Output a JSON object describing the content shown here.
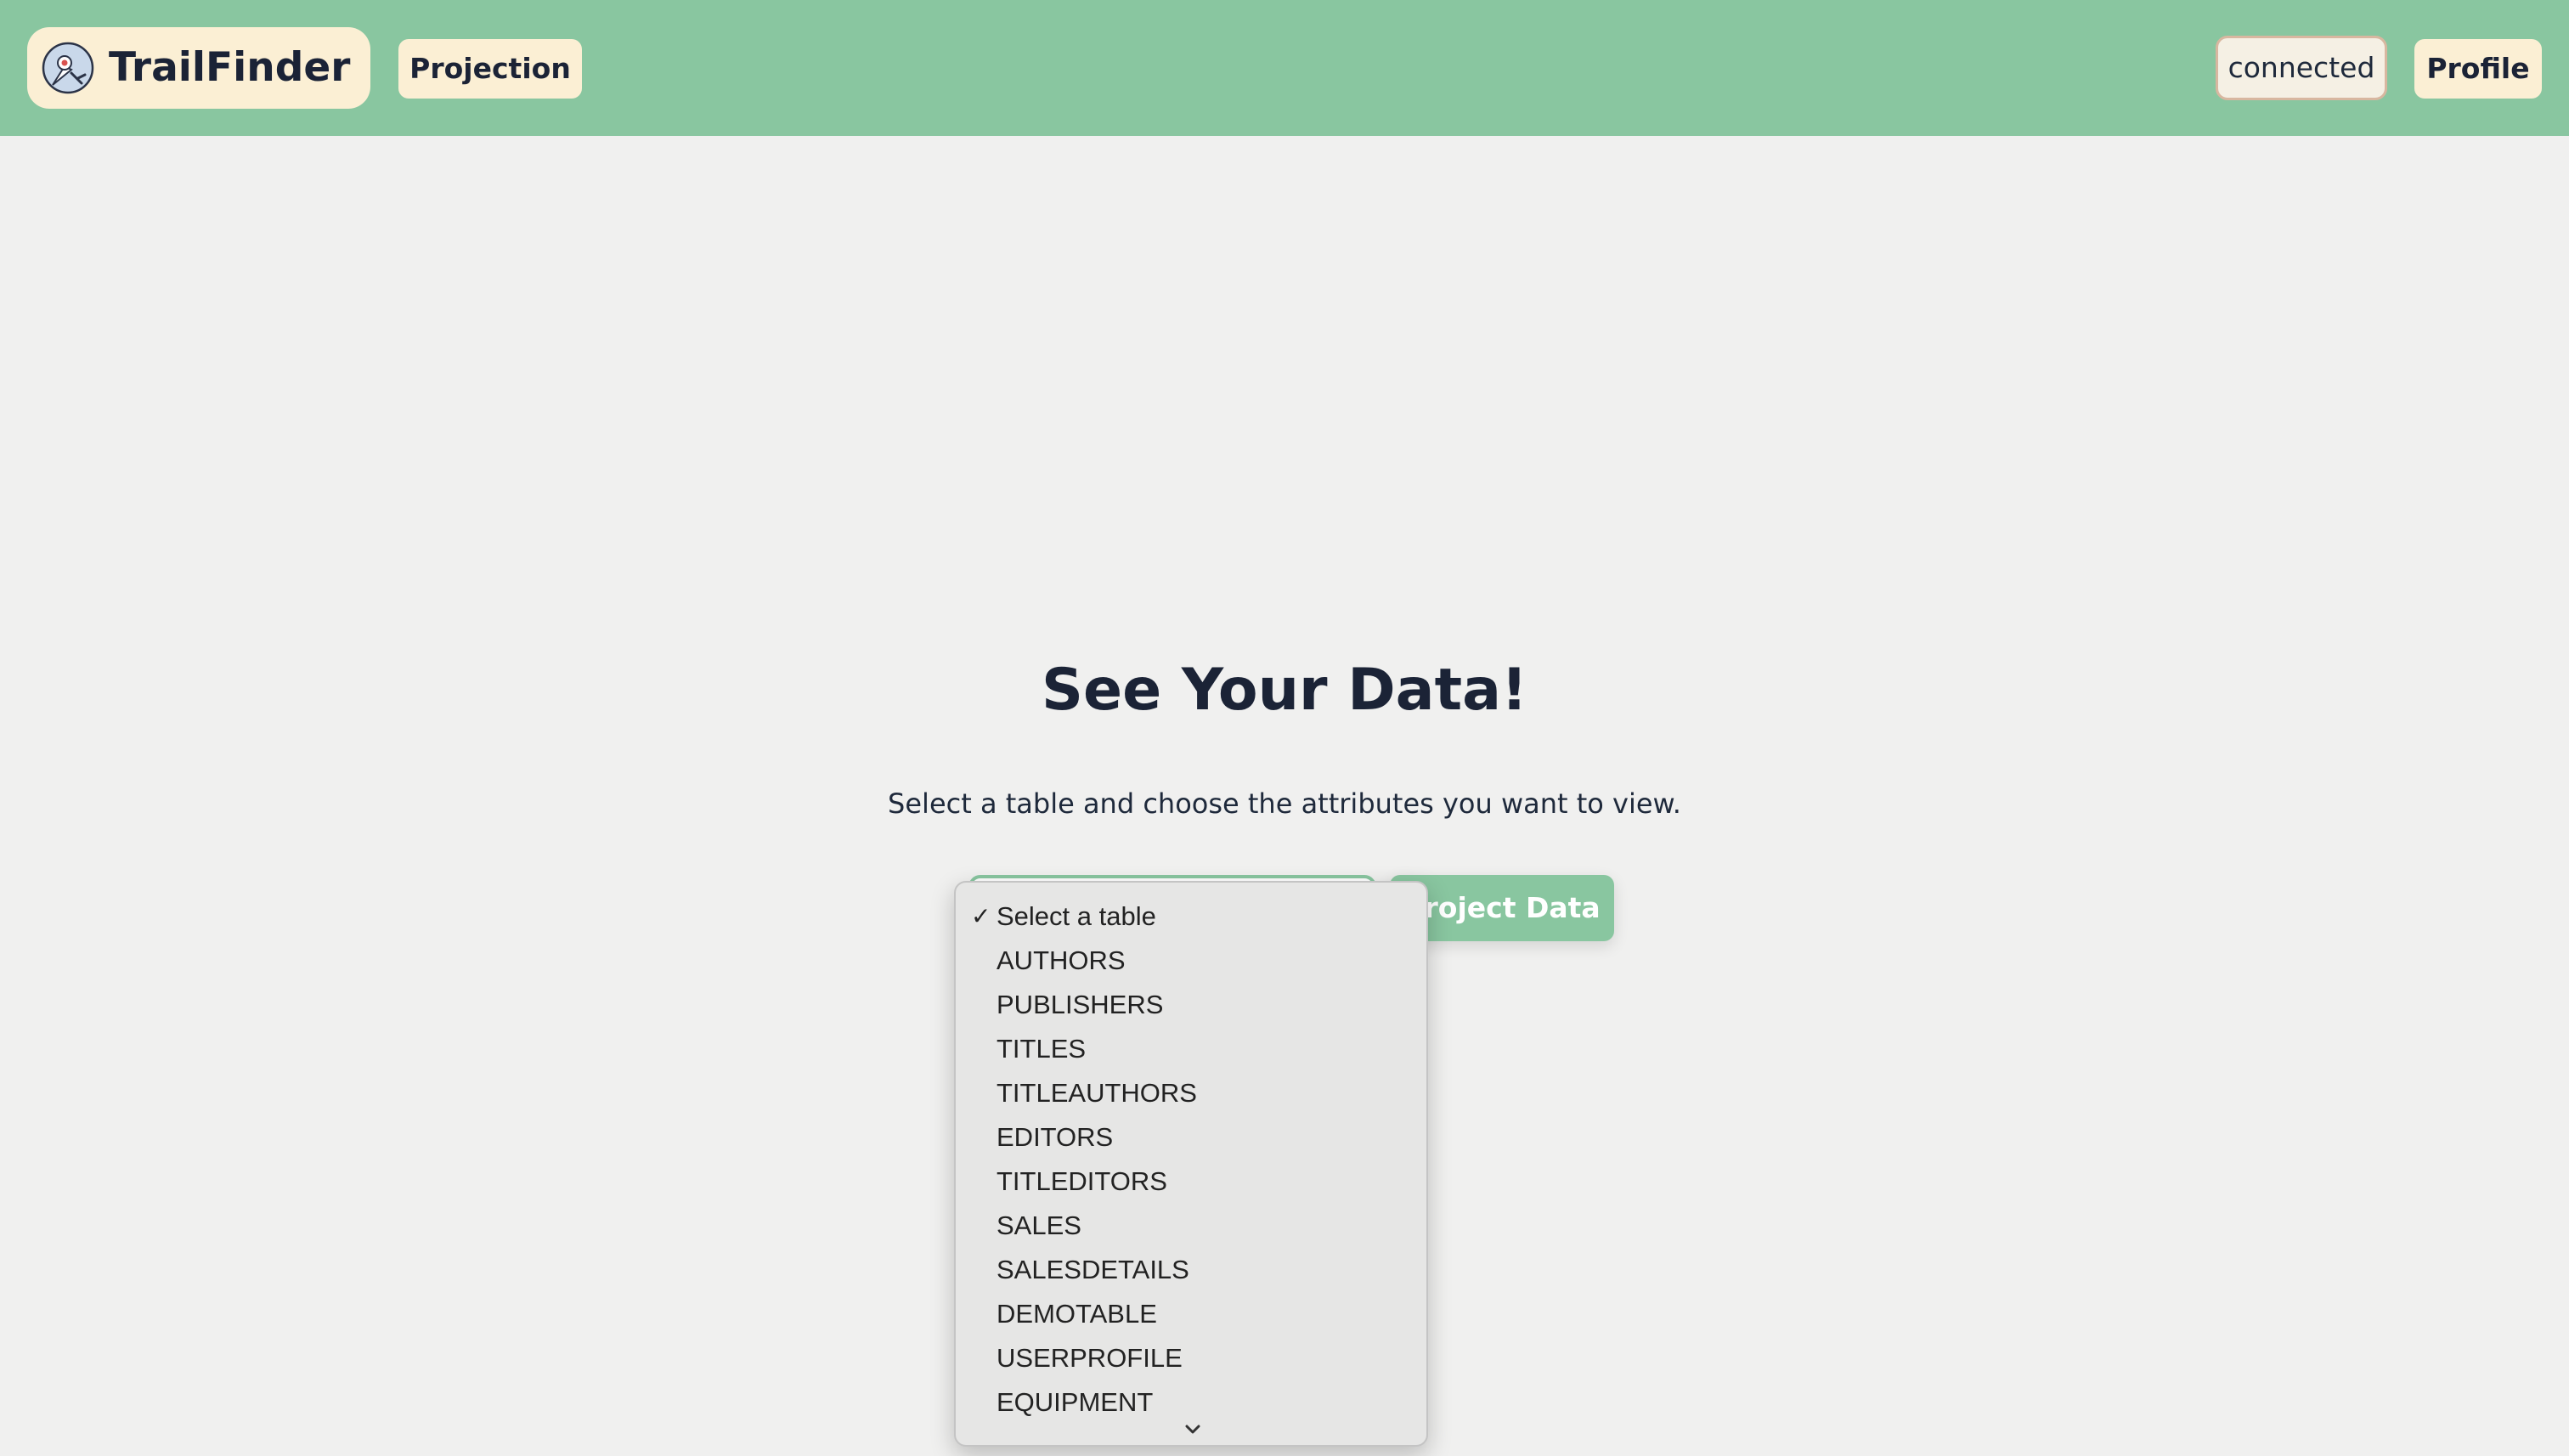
{
  "navbar": {
    "brand_name": "TrailFinder",
    "logo_icon": "compass-pin-icon",
    "projection_label": "Projection",
    "status_text": "connected",
    "profile_label": "Profile",
    "background_color": "#89c6a0",
    "button_color": "#fbefd4"
  },
  "main": {
    "title": "See Your Data!",
    "subtitle": "Select a table and choose the attributes you want to view.",
    "project_button_label": "Project Data"
  },
  "table_select": {
    "selected_value": "Select a table",
    "options": [
      "Select a table",
      "AUTHORS",
      "PUBLISHERS",
      "TITLES",
      "TITLEAUTHORS",
      "EDITORS",
      "TITLEDITORS",
      "SALES",
      "SALESDETAILS",
      "DEMOTABLE",
      "USERPROFILE",
      "EQUIPMENT"
    ],
    "check_glyph": "✓",
    "scroll_icon": "chevron-down-icon"
  }
}
